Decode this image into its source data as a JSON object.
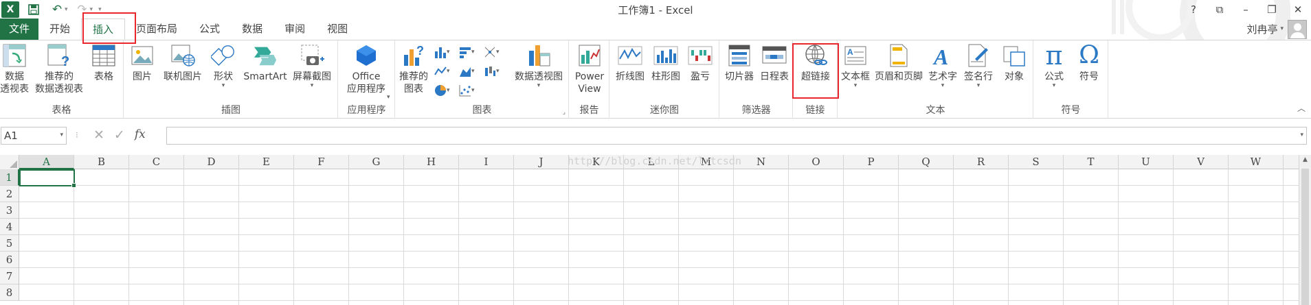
{
  "window": {
    "title": "工作簿1 - Excel",
    "help": "?",
    "restore": "⧉",
    "minimize": "–",
    "maximize": "❐",
    "close": "✕"
  },
  "qat": {
    "logo": "X",
    "save": "💾",
    "undo": "↶",
    "redo": "↷",
    "more": "▾"
  },
  "tabs": [
    {
      "label": "文件"
    },
    {
      "label": "开始"
    },
    {
      "label": "插入"
    },
    {
      "label": "页面布局"
    },
    {
      "label": "公式"
    },
    {
      "label": "数据"
    },
    {
      "label": "审阅"
    },
    {
      "label": "视图"
    }
  ],
  "active_tab": "插入",
  "user": {
    "name": "刘冉亭",
    "caret": "▾"
  },
  "ribbon": {
    "groups": {
      "tables": {
        "label": "表格",
        "buttons": {
          "pivot": "数据\n透视表",
          "rec_pivot": "推荐的\n数据透视表",
          "table": "表格"
        }
      },
      "illustrations": {
        "label": "插图",
        "buttons": {
          "picture": "图片",
          "online_picture": "联机图片",
          "shapes": "形状",
          "smartart": "SmartArt",
          "screenshot": "屏幕截图"
        }
      },
      "apps": {
        "label": "应用程序",
        "buttons": {
          "office": "Office\n应用程序"
        }
      },
      "charts": {
        "label": "图表",
        "buttons": {
          "rec_charts": "推荐的\n图表",
          "pivot_chart": "数据透视图"
        }
      },
      "reports": {
        "label": "报告",
        "buttons": {
          "powerview": "Power\nView"
        }
      },
      "sparklines": {
        "label": "迷你图",
        "buttons": {
          "line": "折线图",
          "column": "柱形图",
          "winloss": "盈亏"
        }
      },
      "filters": {
        "label": "筛选器",
        "buttons": {
          "slicer": "切片器",
          "timeline": "日程表"
        }
      },
      "links": {
        "label": "链接",
        "buttons": {
          "hyperlink": "超链接"
        }
      },
      "text": {
        "label": "文本",
        "buttons": {
          "textbox": "文本框",
          "header_footer": "页眉和页脚",
          "wordart": "艺术字",
          "signature": "签名行",
          "object": "对象"
        }
      },
      "symbols": {
        "label": "符号",
        "buttons": {
          "equation": "公式",
          "symbol": "符号"
        }
      }
    },
    "collapse": "︿"
  },
  "formula_bar": {
    "name_box": "A1",
    "value": "",
    "cancel": "✕",
    "enter": "✓",
    "fx": "fx"
  },
  "watermark": "http://blog.csdn.net/lrtcsdn",
  "columns": [
    "A",
    "B",
    "C",
    "D",
    "E",
    "F",
    "G",
    "H",
    "I",
    "J",
    "K",
    "L",
    "M",
    "N",
    "O",
    "P",
    "Q",
    "R",
    "S",
    "T",
    "U",
    "V",
    "W"
  ],
  "rows": [
    "1",
    "2",
    "3",
    "4",
    "5",
    "6",
    "7",
    "8"
  ],
  "selected_cell": "A1",
  "colors": {
    "accent": "#217346",
    "highlight_box": "#e8262b"
  }
}
